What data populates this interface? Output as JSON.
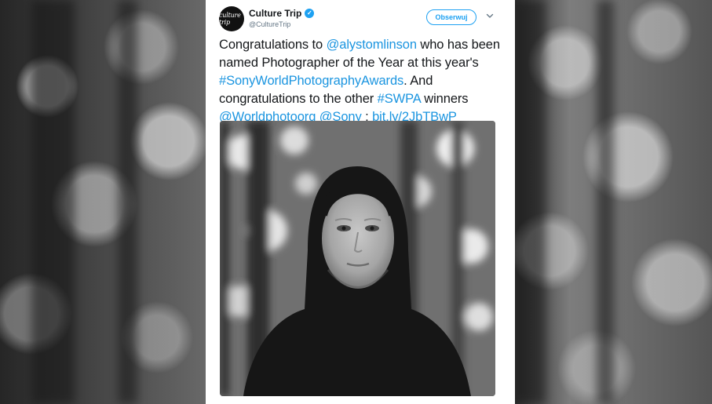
{
  "tweet": {
    "author_name": "Culture Trip",
    "author_handle": "@CultureTrip",
    "avatar_text": "culture trip",
    "follow_label": "Obserwuj",
    "text": {
      "t1": "Congratulations to ",
      "mention1": "@alystomlinson",
      "t2": " who has been named Photographer of the Year at this year's ",
      "hashtag1": "#SonyWorldPhotographyAwards",
      "t3": ". And congratulations to the other ",
      "hashtag2": "#SWPA",
      "t4": " winners ",
      "mention2": "@Worldphotoorg",
      "t5": " ",
      "mention3": "@Sony",
      "t6": " : ",
      "link": "bit.ly/2JbTBwP"
    }
  },
  "icons": {
    "verified": "verified-badge-icon",
    "chevron": "chevron-down-icon"
  },
  "colors": {
    "link": "#1b95e0",
    "verified": "#1da1f2",
    "text": "#14171a",
    "secondary": "#657786"
  }
}
